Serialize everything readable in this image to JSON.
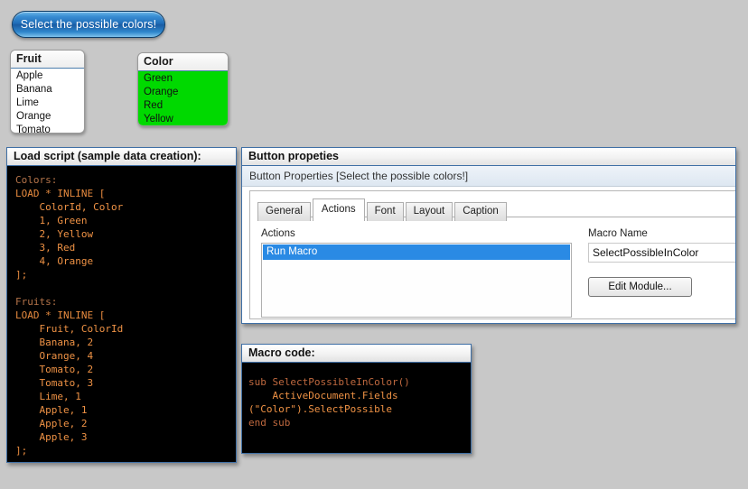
{
  "action_button": {
    "label": "Select the possible colors!",
    "color": "#1f6db8"
  },
  "listboxes": [
    {
      "name": "fruit",
      "caption": "Fruit",
      "items": [
        "Apple",
        "Banana",
        "Lime",
        "Orange",
        "Tomato"
      ],
      "background": "#ffffff"
    },
    {
      "name": "color",
      "caption": "Color",
      "items": [
        "Green",
        "Orange",
        "Red",
        "Yellow"
      ],
      "background": "#00d900"
    }
  ],
  "load_script_panel": {
    "caption": "Load script (sample data creation):",
    "lines": [
      {
        "text": "Colors:",
        "style": "label"
      },
      {
        "text": "LOAD * INLINE [",
        "style": "key"
      },
      {
        "text": "    ColorId, Color",
        "style": "data"
      },
      {
        "text": "    1, Green",
        "style": "data"
      },
      {
        "text": "    2, Yellow",
        "style": "data"
      },
      {
        "text": "    3, Red",
        "style": "data"
      },
      {
        "text": "    4, Orange",
        "style": "data"
      },
      {
        "text": "];",
        "style": "key"
      },
      {
        "text": "",
        "style": "data"
      },
      {
        "text": "Fruits:",
        "style": "label"
      },
      {
        "text": "LOAD * INLINE [",
        "style": "key"
      },
      {
        "text": "    Fruit, ColorId",
        "style": "data"
      },
      {
        "text": "    Banana, 2",
        "style": "data"
      },
      {
        "text": "    Orange, 4",
        "style": "data"
      },
      {
        "text": "    Tomato, 2",
        "style": "data"
      },
      {
        "text": "    Tomato, 3",
        "style": "data"
      },
      {
        "text": "    Lime, 1",
        "style": "data"
      },
      {
        "text": "    Apple, 1",
        "style": "data"
      },
      {
        "text": "    Apple, 2",
        "style": "data"
      },
      {
        "text": "    Apple, 3",
        "style": "data"
      },
      {
        "text": "];",
        "style": "key"
      }
    ]
  },
  "button_properties_panel": {
    "caption": "Button propeties",
    "dialog_title": "Button Properties [Select the possible colors!]",
    "tabs": [
      {
        "label": "General",
        "active": false
      },
      {
        "label": "Actions",
        "active": true
      },
      {
        "label": "Font",
        "active": false
      },
      {
        "label": "Layout",
        "active": false
      },
      {
        "label": "Caption",
        "active": false
      }
    ],
    "actions_label": "Actions",
    "actions_items": [
      "Run Macro"
    ],
    "selected_action": "Run Macro",
    "macro_name_label": "Macro Name",
    "macro_name_value": "SelectPossibleInColor",
    "edit_module_label": "Edit Module...",
    "selection_color": "#2a8ae4"
  },
  "macro_code_panel": {
    "caption": "Macro code:",
    "lines": [
      {
        "text": "sub SelectPossibleInColor()",
        "style": "sub"
      },
      {
        "text": "    ActiveDocument.Fields",
        "style": "data"
      },
      {
        "text": "(\"Color\").SelectPossible",
        "style": "data"
      },
      {
        "text": "end sub",
        "style": "sub"
      }
    ]
  }
}
